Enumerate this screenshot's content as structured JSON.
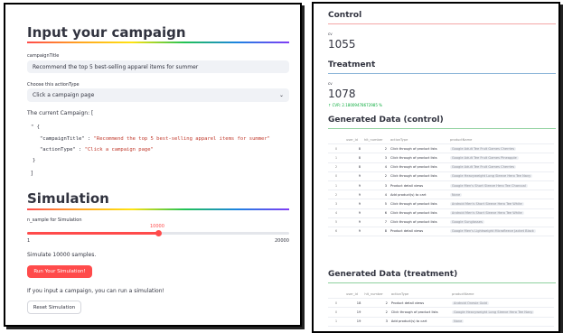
{
  "left": {
    "title": "Input your campaign",
    "campaign_title_label": "campaignTitle",
    "campaign_title_value": "Recommend the top 5 best-selling apparel items for summer",
    "action_type_label": "Choose this actionType",
    "action_type_value": "Click a campaign page",
    "current_campaign_label": "The current Campaign: [",
    "code": {
      "open": "\" {",
      "key1": "\"campaignTitle\"",
      "val1": "\"Recommend the top 5 best-selling apparel items for summer\"",
      "key2": "\"actionType\"",
      "val2": "\"Click a campaign page\"",
      "colon": " : ",
      "comma": ",",
      "close": "}",
      "bracket_close": "]"
    },
    "simulation_title": "Simulation",
    "slider_label": "n_sample for Simulation",
    "slider_value": "10000",
    "slider_min": "1",
    "slider_max": "20000",
    "slider_fraction": 0.5,
    "simulate_text": "Simulate 10000 samples.",
    "run_button": "Run Your Simulation!",
    "info_text": "If you input a campaign, you can run a simulation!",
    "reset_button": "Reset Simulation"
  },
  "right": {
    "control_title": "Control",
    "control_cv_label": "cv",
    "control_cv_value": "1055",
    "treatment_title": "Treatment",
    "treatment_cv_label": "cv",
    "treatment_cv_value": "1078",
    "treatment_delta": "↑ CVR: 2.18009478672985 %",
    "gen_control_title": "Generated Data (control)",
    "gen_treatment_title": "Generated Data (treatment)",
    "columns": [
      "",
      "user_id",
      "hit_number",
      "actionType",
      "productName"
    ],
    "control_rows": [
      [
        "0",
        "8",
        "2",
        "Click through of product lists",
        "Google Adult Tee Fruit Games Cherries"
      ],
      [
        "1",
        "8",
        "3",
        "Click through of product lists",
        "Google Adult Tee Fruit Games Pineapple"
      ],
      [
        "2",
        "8",
        "4",
        "Click through of product lists",
        "Google Adult Tee Fruit Games Cherries"
      ],
      [
        "0",
        "9",
        "2",
        "Click through of product lists",
        "Google Heavyweight Long Sleeve Hero Tee Navy"
      ],
      [
        "1",
        "9",
        "3",
        "Product detail views",
        "Google Men's Short Sleeve Hero Tee Charcoal"
      ],
      [
        "2",
        "9",
        "4",
        "Add product(s) to cart",
        "None"
      ],
      [
        "3",
        "9",
        "5",
        "Click through of product lists",
        "Android Men's Short Sleeve Hero Tee White"
      ],
      [
        "4",
        "9",
        "6",
        "Click through of product lists",
        "Android Men's Short Sleeve Hero Tee White"
      ],
      [
        "5",
        "9",
        "7",
        "Click through of product lists",
        "Google Sunglasses"
      ],
      [
        "6",
        "9",
        "8",
        "Product detail views",
        "Google Men's Lightweight Microfleece Jacket Black"
      ]
    ],
    "treatment_rows": [
      [
        "0",
        "18",
        "2",
        "Product detail views",
        "Android Onesie Gold"
      ],
      [
        "0",
        "19",
        "2",
        "Click through of product lists",
        "Google Heavyweight Long Sleeve Hero Tee Navy"
      ],
      [
        "1",
        "19",
        "3",
        "Add product(s) to cart",
        "None"
      ]
    ]
  },
  "colors": {
    "accent": "#ff4b4b",
    "control_rule": "#f4a6a6",
    "treatment_rule": "#8ab4d8",
    "gen_rule": "#8fd19e",
    "delta_green": "#09ab3b",
    "input_bg": "#f0f2f6"
  }
}
